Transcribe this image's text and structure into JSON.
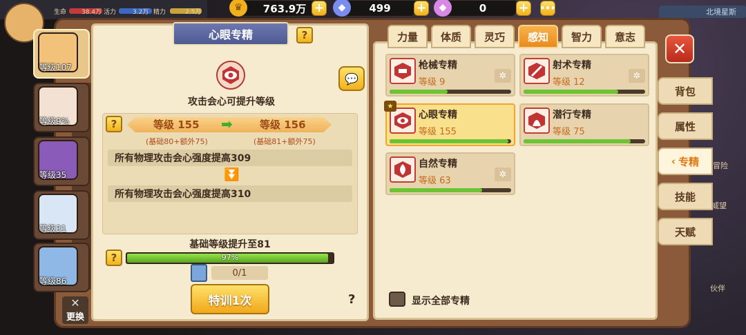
{
  "hud": {
    "life_label": "生命",
    "life_value": "38.4万",
    "vigor_label": "活力",
    "vigor_value": "3.2万",
    "spirit_label": "精力",
    "spirit_value": "2.5万",
    "gold": "763.9万",
    "diamonds": "499",
    "gems": "0",
    "location": "北境星斯"
  },
  "heroes": [
    {
      "level": "等级107",
      "color": "#f2c27a"
    },
    {
      "level": "等级9%",
      "color": "#f3e2d3"
    },
    {
      "level": "等级35",
      "color": "#8a5bb8"
    },
    {
      "level": "等级31",
      "color": "#d9e6f5"
    },
    {
      "level": "等级86",
      "color": "#8fb8e6"
    }
  ],
  "swap_label": "更换",
  "left_panel": {
    "title": "心眼专精",
    "description": "攻击会心可提升等级",
    "level_current": "等级 155",
    "level_next": "等级 156",
    "sub_current": "(基础80+额外75)",
    "sub_next": "(基础81+额外75)",
    "effect_current": "所有物理攻击会心强度提高309",
    "effect_next": "所有物理攻击会心强度提高310",
    "base_upgrade": "基础等级提升至81",
    "progress": 97,
    "progress_text": "97%",
    "count": "0/1",
    "train_button": "特训1次",
    "help": "?"
  },
  "tabs": [
    "力量",
    "体质",
    "灵巧",
    "感知",
    "智力",
    "意志"
  ],
  "active_tab": 3,
  "skills": [
    {
      "name": "枪械专精",
      "level": "等级 9",
      "progress": 0.48,
      "spin": true
    },
    {
      "name": "射术专精",
      "level": "等级 12",
      "progress": 0.78,
      "spin": true
    },
    {
      "name": "心眼专精",
      "level": "等级 155",
      "progress": 0.98,
      "spin": false,
      "selected": true
    },
    {
      "name": "潜行专精",
      "level": "等级 75",
      "progress": 0.88,
      "spin": false
    },
    {
      "name": "自然专精",
      "level": "等级 63",
      "progress": 0.76,
      "spin": true
    }
  ],
  "show_all_label": "显示全部专精",
  "side_nav": [
    "背包",
    "属性",
    "专精",
    "技能",
    "天赋"
  ],
  "side_nav_active": 2,
  "bg_labels": {
    "adventure": "冒险",
    "prestige": "威望",
    "partner": "伙伴"
  }
}
